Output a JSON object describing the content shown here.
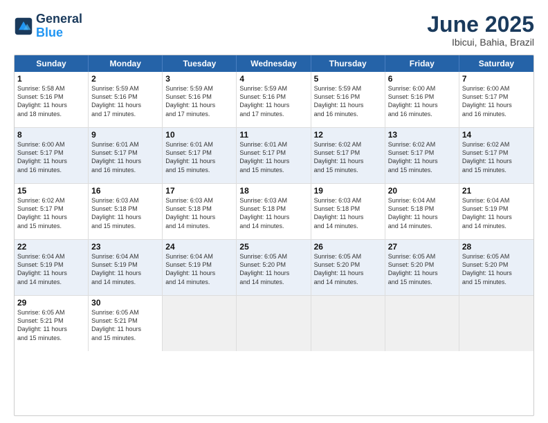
{
  "header": {
    "logo_line1": "General",
    "logo_line2": "Blue",
    "title": "June 2025",
    "subtitle": "Ibicui, Bahia, Brazil"
  },
  "weekdays": [
    "Sunday",
    "Monday",
    "Tuesday",
    "Wednesday",
    "Thursday",
    "Friday",
    "Saturday"
  ],
  "rows": [
    [
      {
        "day": "1",
        "info": "Sunrise: 5:58 AM\nSunset: 5:16 PM\nDaylight: 11 hours\nand 18 minutes."
      },
      {
        "day": "2",
        "info": "Sunrise: 5:59 AM\nSunset: 5:16 PM\nDaylight: 11 hours\nand 17 minutes."
      },
      {
        "day": "3",
        "info": "Sunrise: 5:59 AM\nSunset: 5:16 PM\nDaylight: 11 hours\nand 17 minutes."
      },
      {
        "day": "4",
        "info": "Sunrise: 5:59 AM\nSunset: 5:16 PM\nDaylight: 11 hours\nand 17 minutes."
      },
      {
        "day": "5",
        "info": "Sunrise: 5:59 AM\nSunset: 5:16 PM\nDaylight: 11 hours\nand 16 minutes."
      },
      {
        "day": "6",
        "info": "Sunrise: 6:00 AM\nSunset: 5:16 PM\nDaylight: 11 hours\nand 16 minutes."
      },
      {
        "day": "7",
        "info": "Sunrise: 6:00 AM\nSunset: 5:17 PM\nDaylight: 11 hours\nand 16 minutes."
      }
    ],
    [
      {
        "day": "8",
        "info": "Sunrise: 6:00 AM\nSunset: 5:17 PM\nDaylight: 11 hours\nand 16 minutes."
      },
      {
        "day": "9",
        "info": "Sunrise: 6:01 AM\nSunset: 5:17 PM\nDaylight: 11 hours\nand 16 minutes."
      },
      {
        "day": "10",
        "info": "Sunrise: 6:01 AM\nSunset: 5:17 PM\nDaylight: 11 hours\nand 15 minutes."
      },
      {
        "day": "11",
        "info": "Sunrise: 6:01 AM\nSunset: 5:17 PM\nDaylight: 11 hours\nand 15 minutes."
      },
      {
        "day": "12",
        "info": "Sunrise: 6:02 AM\nSunset: 5:17 PM\nDaylight: 11 hours\nand 15 minutes."
      },
      {
        "day": "13",
        "info": "Sunrise: 6:02 AM\nSunset: 5:17 PM\nDaylight: 11 hours\nand 15 minutes."
      },
      {
        "day": "14",
        "info": "Sunrise: 6:02 AM\nSunset: 5:17 PM\nDaylight: 11 hours\nand 15 minutes."
      }
    ],
    [
      {
        "day": "15",
        "info": "Sunrise: 6:02 AM\nSunset: 5:17 PM\nDaylight: 11 hours\nand 15 minutes."
      },
      {
        "day": "16",
        "info": "Sunrise: 6:03 AM\nSunset: 5:18 PM\nDaylight: 11 hours\nand 15 minutes."
      },
      {
        "day": "17",
        "info": "Sunrise: 6:03 AM\nSunset: 5:18 PM\nDaylight: 11 hours\nand 14 minutes."
      },
      {
        "day": "18",
        "info": "Sunrise: 6:03 AM\nSunset: 5:18 PM\nDaylight: 11 hours\nand 14 minutes."
      },
      {
        "day": "19",
        "info": "Sunrise: 6:03 AM\nSunset: 5:18 PM\nDaylight: 11 hours\nand 14 minutes."
      },
      {
        "day": "20",
        "info": "Sunrise: 6:04 AM\nSunset: 5:18 PM\nDaylight: 11 hours\nand 14 minutes."
      },
      {
        "day": "21",
        "info": "Sunrise: 6:04 AM\nSunset: 5:19 PM\nDaylight: 11 hours\nand 14 minutes."
      }
    ],
    [
      {
        "day": "22",
        "info": "Sunrise: 6:04 AM\nSunset: 5:19 PM\nDaylight: 11 hours\nand 14 minutes."
      },
      {
        "day": "23",
        "info": "Sunrise: 6:04 AM\nSunset: 5:19 PM\nDaylight: 11 hours\nand 14 minutes."
      },
      {
        "day": "24",
        "info": "Sunrise: 6:04 AM\nSunset: 5:19 PM\nDaylight: 11 hours\nand 14 minutes."
      },
      {
        "day": "25",
        "info": "Sunrise: 6:05 AM\nSunset: 5:20 PM\nDaylight: 11 hours\nand 14 minutes."
      },
      {
        "day": "26",
        "info": "Sunrise: 6:05 AM\nSunset: 5:20 PM\nDaylight: 11 hours\nand 14 minutes."
      },
      {
        "day": "27",
        "info": "Sunrise: 6:05 AM\nSunset: 5:20 PM\nDaylight: 11 hours\nand 15 minutes."
      },
      {
        "day": "28",
        "info": "Sunrise: 6:05 AM\nSunset: 5:20 PM\nDaylight: 11 hours\nand 15 minutes."
      }
    ],
    [
      {
        "day": "29",
        "info": "Sunrise: 6:05 AM\nSunset: 5:21 PM\nDaylight: 11 hours\nand 15 minutes."
      },
      {
        "day": "30",
        "info": "Sunrise: 6:05 AM\nSunset: 5:21 PM\nDaylight: 11 hours\nand 15 minutes."
      },
      {
        "day": "",
        "info": ""
      },
      {
        "day": "",
        "info": ""
      },
      {
        "day": "",
        "info": ""
      },
      {
        "day": "",
        "info": ""
      },
      {
        "day": "",
        "info": ""
      }
    ]
  ]
}
